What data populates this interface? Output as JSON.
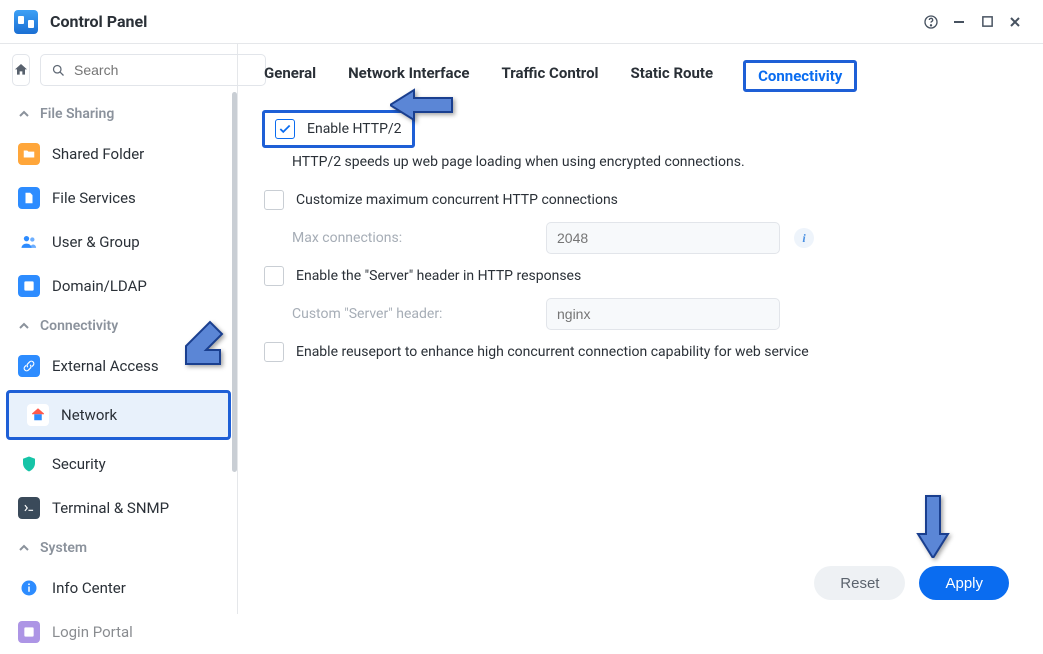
{
  "window": {
    "title": "Control Panel"
  },
  "search": {
    "placeholder": "Search"
  },
  "sidebar": {
    "sections": [
      {
        "label": "File Sharing",
        "items": [
          {
            "label": "Shared Folder"
          },
          {
            "label": "File Services"
          },
          {
            "label": "User & Group"
          },
          {
            "label": "Domain/LDAP"
          }
        ]
      },
      {
        "label": "Connectivity",
        "items": [
          {
            "label": "External Access"
          },
          {
            "label": "Network"
          },
          {
            "label": "Security"
          },
          {
            "label": "Terminal & SNMP"
          }
        ]
      },
      {
        "label": "System",
        "items": [
          {
            "label": "Info Center"
          },
          {
            "label": "Login Portal"
          }
        ]
      }
    ]
  },
  "tabs": [
    {
      "label": "General"
    },
    {
      "label": "Network Interface"
    },
    {
      "label": "Traffic Control"
    },
    {
      "label": "Static Route"
    },
    {
      "label": "Connectivity"
    }
  ],
  "content": {
    "enable_http2": {
      "label": "Enable HTTP/2",
      "checked": true
    },
    "http2_help": "HTTP/2 speeds up web page loading when using encrypted connections.",
    "customize_max": {
      "label": "Customize maximum concurrent HTTP connections",
      "checked": false
    },
    "max_conn": {
      "label": "Max connections:",
      "placeholder": "2048"
    },
    "enable_server_header": {
      "label": "Enable the \"Server\" header in HTTP responses",
      "checked": false
    },
    "custom_header": {
      "label": "Custom \"Server\" header:",
      "placeholder": "nginx"
    },
    "enable_reuseport": {
      "label": "Enable reuseport to enhance high concurrent connection capability for web service",
      "checked": false
    }
  },
  "footer": {
    "reset": "Reset",
    "apply": "Apply"
  }
}
